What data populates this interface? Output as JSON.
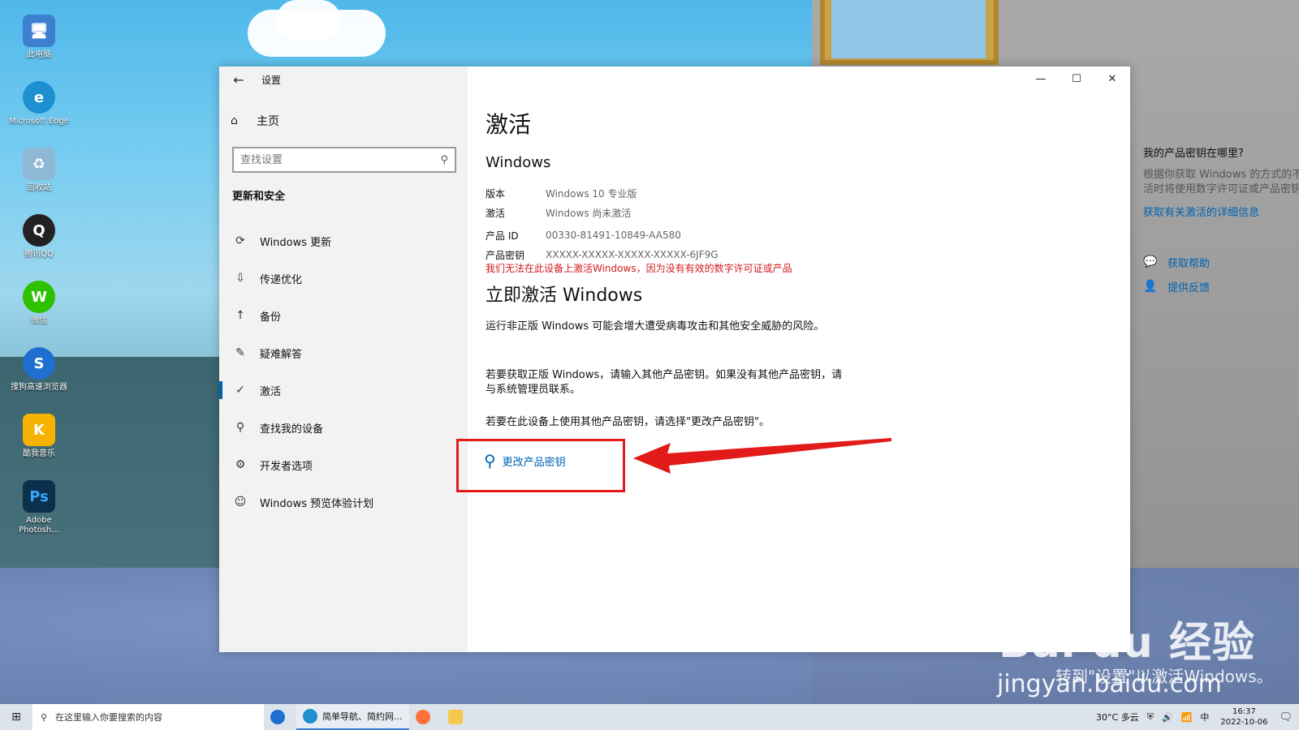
{
  "desktop": {
    "icons": [
      {
        "label": "此电脑",
        "color": "#3e7fd0",
        "glyph": "🖥"
      },
      {
        "label": "Microsoft Edge",
        "color": "#1e8fd0",
        "glyph": "e"
      },
      {
        "label": "回收站",
        "color": "#8fb7d6",
        "glyph": "♻"
      },
      {
        "label": "腾讯QQ",
        "color": "#222222",
        "glyph": "Q"
      },
      {
        "label": "微信",
        "color": "#2dc100",
        "glyph": "W"
      },
      {
        "label": "搜狗高速浏览器",
        "color": "#1f6fd1",
        "glyph": "S"
      },
      {
        "label": "酷我音乐",
        "color": "#f5b300",
        "glyph": "K"
      },
      {
        "label": "Adobe Photosh...",
        "color": "#0c2f4d",
        "glyph": "Ps"
      }
    ]
  },
  "window": {
    "title": "设置",
    "back_icon": "←",
    "controls": {
      "minimize": "—",
      "maximize": "☐",
      "close": "✕"
    }
  },
  "sidebar": {
    "home_label": "主页",
    "search_placeholder": "查找设置",
    "section_title": "更新和安全",
    "items": [
      {
        "label": "Windows 更新",
        "icon": "⟳"
      },
      {
        "label": "传递优化",
        "icon": "⇩"
      },
      {
        "label": "备份",
        "icon": "↑"
      },
      {
        "label": "疑难解答",
        "icon": "✎"
      },
      {
        "label": "激活",
        "icon": "✓",
        "active": true
      },
      {
        "label": "查找我的设备",
        "icon": "⚲"
      },
      {
        "label": "开发者选项",
        "icon": "⚙"
      },
      {
        "label": "Windows 预览体验计划",
        "icon": "☺"
      }
    ]
  },
  "main": {
    "page_title": "激活",
    "windows_heading": "Windows",
    "info": [
      {
        "key": "版本",
        "value": "Windows 10 专业版"
      },
      {
        "key": "激活",
        "value": "Windows 尚未激活"
      },
      {
        "key": "产品 ID",
        "value": "00330-81491-10849-AA580"
      },
      {
        "key": "产品密钥",
        "value": "XXXXX-XXXXX-XXXXX-XXXXX-6JF9G"
      }
    ],
    "error": "我们无法在此设备上激活Windows，因为没有有效的数字许可证或产品",
    "activate_heading": "立即激活 Windows",
    "para1": "运行非正版 Windows 可能会增大遭受病毒攻击和其他安全威胁的风险。",
    "para2": "若要获取正版 Windows，请输入其他产品密钥。如果没有其他产品密钥，请与系统管理员联系。",
    "para3": "若要在此设备上使用其他产品密钥，请选择\"更改产品密钥\"。",
    "change_key_label": "更改产品密钥"
  },
  "right_panel": {
    "title": "我的产品密钥在哪里?",
    "desc": "根据你获取 Windows 的方式的不同，激活时将使用数字许可证或产品密钥。",
    "link": "获取有关激活的详细信息",
    "help": "获取帮助",
    "feedback": "提供反馈"
  },
  "watermark": {
    "logo": "Bai du 经验",
    "caption": "转到\"设置\"以激活Windows。",
    "url": "jingyan.baidu.com"
  },
  "taskbar": {
    "search_text": "在这里输入你要搜索的内容",
    "app_active": "简单导航、简约网...",
    "weather": "30°C 多云",
    "ime": "中",
    "time": "16:37",
    "date": "2022-10-06"
  },
  "colors": {
    "accent": "#0063b1",
    "error": "#d21a1a",
    "highlight": "#e21a1a"
  }
}
